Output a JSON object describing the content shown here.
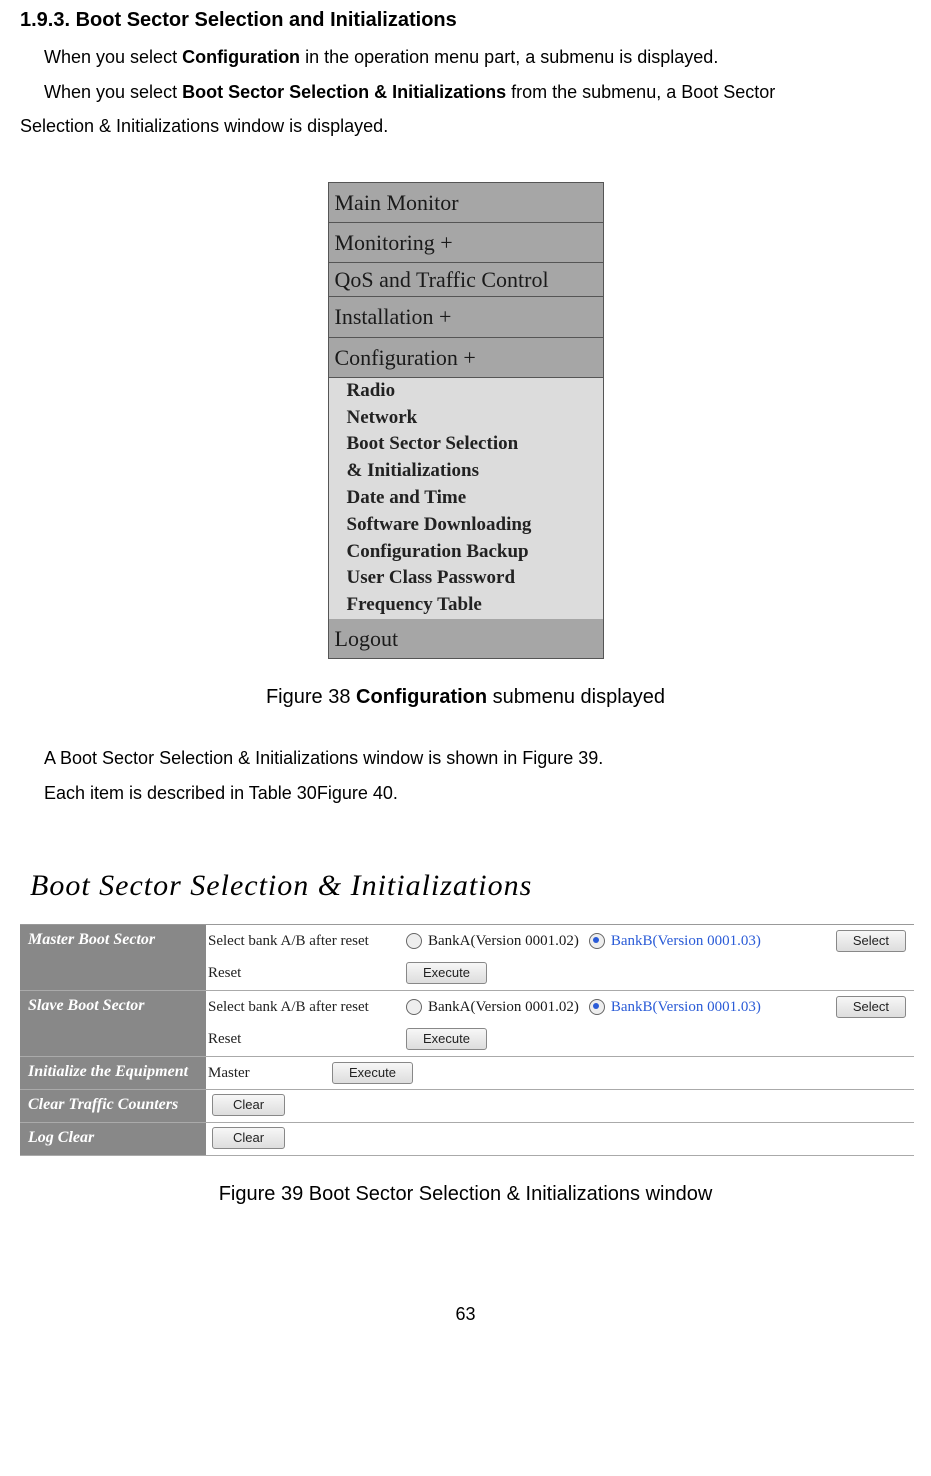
{
  "heading": "1.9.3. Boot Sector Selection and Initializations",
  "para1_pre": "When you select ",
  "para1_bold": "Configuration",
  "para1_post": " in the operation menu part, a submenu is displayed.",
  "para2_pre": "When you select ",
  "para2_bold": "Boot Sector Selection & Initializations",
  "para2_post": " from the submenu, a Boot Sector",
  "para2_line2": "Selection & Initializations window is displayed.",
  "menu": {
    "items": [
      "Main Monitor",
      "Monitoring +",
      "QoS and Traffic Control",
      "Installation +",
      "Configuration +"
    ],
    "submenu": [
      "Radio",
      "Network",
      "Boot Sector Selection",
      "& Initializations",
      "Date and Time",
      "Software Downloading",
      "Configuration Backup",
      "User Class Password",
      "Frequency Table"
    ],
    "logout": "Logout"
  },
  "fig38_caption_pre": "Figure 38 ",
  "fig38_caption_bold": "Configuration",
  "fig38_caption_post": " submenu displayed",
  "para3": "A Boot Sector Selection & Initializations window is shown in Figure 39.",
  "para4": "Each item is described in Table 30Figure 40.",
  "window": {
    "title": "Boot Sector Selection & Initializations",
    "master": {
      "label": "Master Boot Sector",
      "select_text": "Select bank A/B after reset",
      "reset_text": "Reset",
      "bankA": "BankA(Version 0001.02)",
      "bankB": "BankB(Version 0001.03)",
      "select_btn": "Select",
      "execute_btn": "Execute"
    },
    "slave": {
      "label": "Slave Boot Sector",
      "select_text": "Select bank A/B after reset",
      "reset_text": "Reset",
      "bankA": "BankA(Version 0001.02)",
      "bankB": "BankB(Version 0001.03)",
      "select_btn": "Select",
      "execute_btn": "Execute"
    },
    "init": {
      "label": "Initialize the Equipment",
      "master_text": "Master",
      "execute_btn": "Execute"
    },
    "clear_traffic": {
      "label": "Clear Traffic Counters",
      "btn": "Clear"
    },
    "log_clear": {
      "label": "Log Clear",
      "btn": "Clear"
    }
  },
  "fig39_caption": "Figure 39 Boot Sector Selection & Initializations window",
  "page_number": "63"
}
